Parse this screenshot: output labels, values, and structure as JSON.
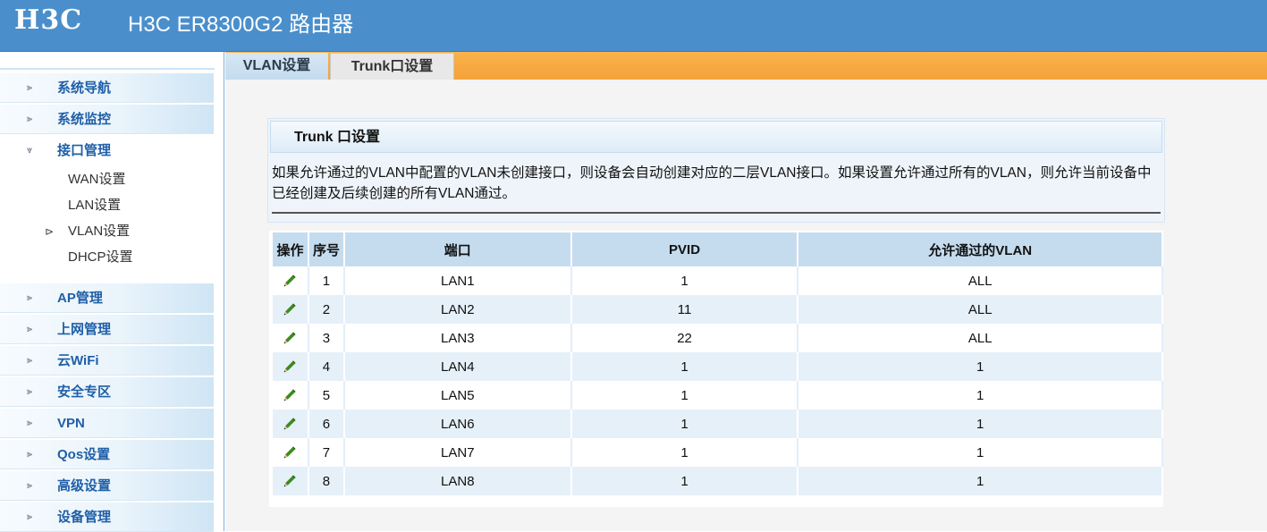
{
  "header": {
    "logo": "H3C",
    "product_title": "H3C ER8300G2 路由器"
  },
  "sidebar": {
    "items": [
      {
        "label": "系统导航"
      },
      {
        "label": "系统监控"
      },
      {
        "label": "接口管理",
        "expanded": true,
        "children": [
          {
            "label": "WAN设置"
          },
          {
            "label": "LAN设置"
          },
          {
            "label": "VLAN设置",
            "selected": true
          },
          {
            "label": "DHCP设置"
          }
        ]
      },
      {
        "label": "AP管理"
      },
      {
        "label": "上网管理"
      },
      {
        "label": "云WiFi"
      },
      {
        "label": "安全专区"
      },
      {
        "label": "VPN"
      },
      {
        "label": "Qos设置"
      },
      {
        "label": "高级设置"
      },
      {
        "label": "设备管理"
      }
    ]
  },
  "tabs": [
    {
      "label": "VLAN设置",
      "active": false
    },
    {
      "label": "Trunk口设置",
      "active": true
    }
  ],
  "panel": {
    "title": "Trunk 口设置",
    "description": "如果允许通过的VLAN中配置的VLAN未创建接口，则设备会自动创建对应的二层VLAN接口。如果设置允许通过所有的VLAN，则允许当前设备中已经创建及后续创建的所有VLAN通过。"
  },
  "table": {
    "headers": [
      "操作",
      "序号",
      "端口",
      "PVID",
      "允许通过的VLAN"
    ],
    "rows": [
      {
        "seq": "1",
        "port": "LAN1",
        "pvid": "1",
        "allowed": "ALL"
      },
      {
        "seq": "2",
        "port": "LAN2",
        "pvid": "11",
        "allowed": "ALL"
      },
      {
        "seq": "3",
        "port": "LAN3",
        "pvid": "22",
        "allowed": "ALL"
      },
      {
        "seq": "4",
        "port": "LAN4",
        "pvid": "1",
        "allowed": "1"
      },
      {
        "seq": "5",
        "port": "LAN5",
        "pvid": "1",
        "allowed": "1"
      },
      {
        "seq": "6",
        "port": "LAN6",
        "pvid": "1",
        "allowed": "1"
      },
      {
        "seq": "7",
        "port": "LAN7",
        "pvid": "1",
        "allowed": "1"
      },
      {
        "seq": "8",
        "port": "LAN8",
        "pvid": "1",
        "allowed": "1"
      }
    ]
  },
  "icons": {
    "menu_collapsed": "arrow-right-icon",
    "menu_expanded": "arrow-down-icon",
    "edit": "pencil-icon"
  },
  "colors": {
    "header_blue": "#4a8fcc",
    "tab_orange": "#f5a23a",
    "menu_label_blue": "#1f5fa8",
    "table_header": "#c5dcef",
    "row_alt": "#e6f0f9",
    "pencil_green": "#3d8b1f"
  }
}
